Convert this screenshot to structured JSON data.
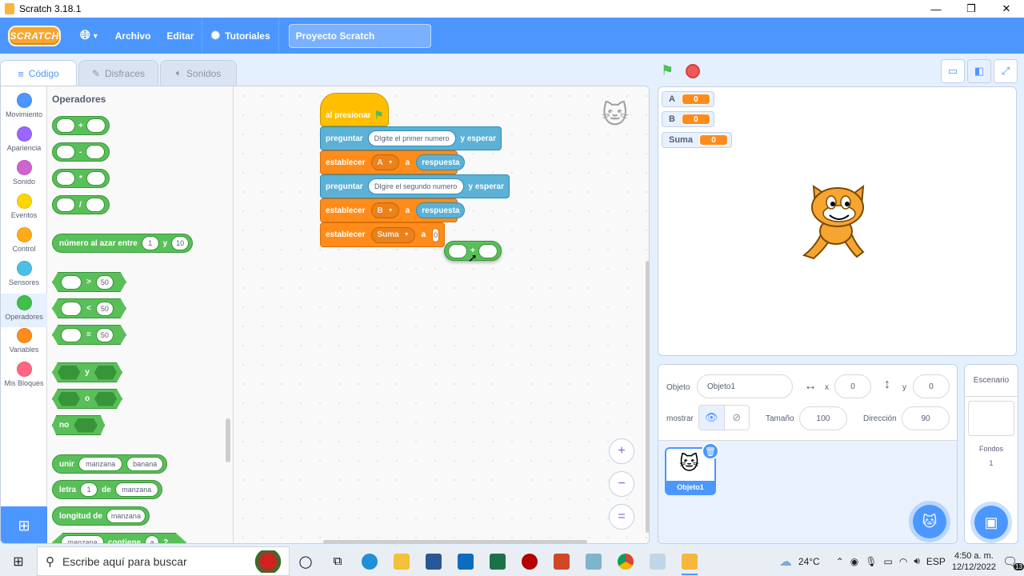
{
  "window": {
    "title": "Scratch 3.18.1",
    "controls": [
      "—",
      "❐",
      "✕"
    ]
  },
  "menubar": {
    "logo": "SCRATCH",
    "items": [
      "Archivo",
      "Editar"
    ],
    "tutorials": "Tutoriales",
    "project_title": "Proyecto Scratch"
  },
  "tabs": [
    {
      "label": "Código",
      "icon": "code-icon"
    },
    {
      "label": "Disfraces",
      "icon": "brush-icon"
    },
    {
      "label": "Sonidos",
      "icon": "speaker-icon"
    }
  ],
  "categories": [
    {
      "label": "Movimiento",
      "color": "#4c97ff"
    },
    {
      "label": "Apariencia",
      "color": "#9966ff"
    },
    {
      "label": "Sonido",
      "color": "#cf63cf"
    },
    {
      "label": "Eventos",
      "color": "#ffd500"
    },
    {
      "label": "Control",
      "color": "#ffab19"
    },
    {
      "label": "Sensores",
      "color": "#4cbfe6"
    },
    {
      "label": "Operadores",
      "color": "#40bf4a"
    },
    {
      "label": "Variables",
      "color": "#ff8c1a"
    },
    {
      "label": "Mis Bloques",
      "color": "#ff6680"
    }
  ],
  "palette": {
    "title": "Operadores",
    "arith": [
      "+",
      "-",
      "*",
      "/"
    ],
    "random": {
      "label": "número al azar entre",
      "from": "1",
      "and": "y",
      "to": "10"
    },
    "compare": [
      {
        "op": ">",
        "value": "50"
      },
      {
        "op": "<",
        "value": "50"
      },
      {
        "op": "=",
        "value": "50"
      }
    ],
    "logic": {
      "and": "y",
      "or": "o",
      "not": "no"
    },
    "join": {
      "label": "unir",
      "a": "manzana",
      "b": "banana"
    },
    "letter": {
      "label": "letra",
      "index": "1",
      "of": "de",
      "word": "manzana"
    },
    "length": {
      "label": "longitud de",
      "word": "manzana"
    },
    "contains": {
      "word": "manzana",
      "label": "contiene",
      "char": "a",
      "q": "?"
    }
  },
  "script": {
    "hat": "al presionar",
    "ask1": {
      "label": "preguntar",
      "text": "DIgite el primer numero",
      "suffix": "y esperar"
    },
    "set1": {
      "label": "establecer",
      "var": "A",
      "to": "a",
      "value": "respuesta"
    },
    "ask2": {
      "label": "preguntar",
      "text": "DIgire el segundo numero",
      "suffix": "y esperar"
    },
    "set2": {
      "label": "establecer",
      "var": "B",
      "to": "a",
      "value": "respuesta"
    },
    "set3": {
      "label": "establecer",
      "var": "Suma",
      "to": "a",
      "value": "0"
    },
    "floating_op": "+"
  },
  "zoom": {
    "in": "+",
    "out": "−",
    "reset": "="
  },
  "monitors": [
    {
      "name": "A",
      "value": "0"
    },
    {
      "name": "B",
      "value": "0"
    },
    {
      "name": "Suma",
      "value": "0"
    }
  ],
  "sprite_info": {
    "sprite_label": "Objeto",
    "sprite_name": "Objeto1",
    "x_label": "x",
    "x": "0",
    "y_label": "y",
    "y": "0",
    "show_label": "mostrar",
    "size_label": "Tamaño",
    "size": "100",
    "direction_label": "Dirección",
    "direction": "90"
  },
  "sprites": [
    {
      "name": "Objeto1"
    }
  ],
  "stage_panel": {
    "title": "Escenario",
    "backdrops_label": "Fondos",
    "backdrops_count": "1"
  },
  "taskbar": {
    "search_placeholder": "Escribe aquí para buscar",
    "weather": "24°C",
    "lang": "ESP",
    "time": "4:50 a. m.",
    "date": "12/12/2022",
    "notif_count": "13"
  }
}
